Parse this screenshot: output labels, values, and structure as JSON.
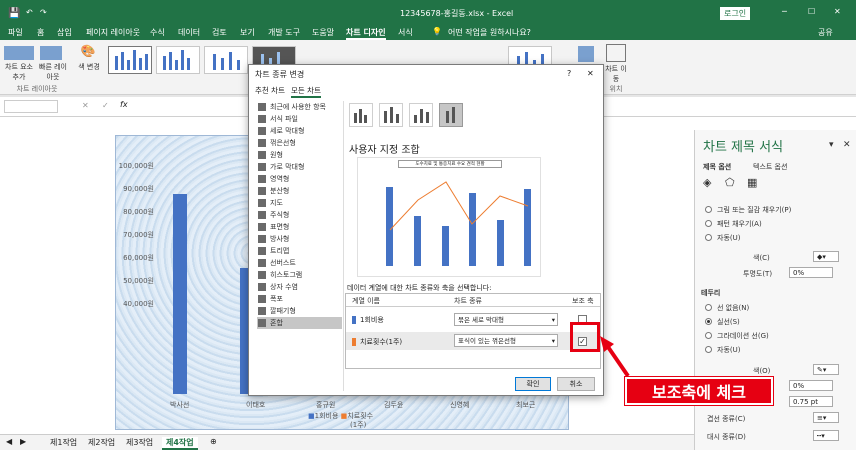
{
  "window": {
    "title": "12345678-홍길동.xlsx  -  Excel",
    "login_label": "로그인",
    "share_label": "공유"
  },
  "ribbon_tabs": [
    "파일",
    "홈",
    "삽입",
    "페이지 레이아웃",
    "수식",
    "데이터",
    "검토",
    "보기",
    "개발 도구",
    "도움말",
    "차트 디자인",
    "서식"
  ],
  "search_placeholder": "어떤 작업을 원하시나요?",
  "ribbon": {
    "add_element": "차트 요소 추가",
    "quick_layout": "빠른 레이아웃",
    "layout_group": "차트 레이아웃",
    "change_color": "색 변경",
    "move_chart": "차트 이동",
    "location_group": "위치"
  },
  "chart": {
    "y_ticks": [
      "100,000원",
      "90,000원",
      "80,000원",
      "70,000원",
      "60,000원",
      "50,000원",
      "40,000원"
    ],
    "x_categories": [
      "박사선",
      "이태호",
      "홍규원",
      "김두윤",
      "신영혜",
      "최보근"
    ],
    "legend_1": "1회비용",
    "legend_2": "치료횟수",
    "legend_2_sub": "(1주)"
  },
  "chart_data": {
    "type": "bar",
    "categories": [
      "박사선",
      "이태호",
      "홍규원",
      "김두윤",
      "신영혜",
      "최보근"
    ],
    "series": [
      {
        "name": "1회비용",
        "values": [
          86000,
          55000,
          null,
          null,
          null,
          null
        ]
      }
    ],
    "y_ticks": [
      "100,000원",
      "90,000원",
      "80,000원",
      "70,000원",
      "60,000원",
      "50,000원",
      "40,000원"
    ]
  },
  "dialog": {
    "title": "차트 종류 변경",
    "help": "?",
    "close": "✕",
    "tab_recommended": "추천 차트",
    "tab_all": "모든 차트",
    "chart_types": [
      "최근에 사용한 항목",
      "서식 파일",
      "세로 막대형",
      "꺾은선형",
      "원형",
      "가로 막대형",
      "영역형",
      "분산형",
      "지도",
      "주식형",
      "표면형",
      "방사형",
      "트리맵",
      "선버스트",
      "히스토그램",
      "상자 수염",
      "폭포",
      "깔때기형",
      "혼합"
    ],
    "section_title": "사용자 지정 조합",
    "preview_title": "도수치료 및 통증치료 수요 견적 현황",
    "series_prompt": "데이터 계열에 대한 차트 종류와 축을 선택합니다:",
    "col_name": "계열 이름",
    "col_type": "차트 종류",
    "col_axis": "보조 축",
    "series_rows": [
      {
        "name": "1회비용",
        "type": "묶은 세로 막대형",
        "secondary": false,
        "color": "#4472c4"
      },
      {
        "name": "치료횟수(1주)",
        "type": "표식이 있는 꺾은선형",
        "secondary": true,
        "color": "#ed7d31"
      }
    ],
    "ok": "확인",
    "cancel": "취소"
  },
  "format_pane": {
    "title": "차트 제목 서식",
    "tab_title_options": "제목 옵션",
    "tab_text_options": "텍스트 옵션",
    "fill_options": [
      "그림 또는 질감 채우기(P)",
      "패턴 채우기(A)",
      "자동(U)"
    ],
    "color_label": "색(C)",
    "transparency_label": "투명도(T)",
    "transparency_value": "0%",
    "border_section": "테두리",
    "border_options": [
      "선 없음(N)",
      "실선(S)",
      "그라데이션 선(G)",
      "자동(U)"
    ],
    "border_selected": 1,
    "color2_label": "색(O)",
    "transparency2_value": "0%",
    "width_value": "0.75 pt",
    "compound_label": "겹선 종류(C)",
    "dash_label": "대시 종류(D)"
  },
  "sheet_tabs": [
    "제1작업",
    "제2작업",
    "제3작업",
    "제4작업"
  ],
  "active_sheet": "제4작업",
  "annotation": {
    "callout": "보조축에 체크",
    "color": "#e60012"
  },
  "accent": "#217346"
}
